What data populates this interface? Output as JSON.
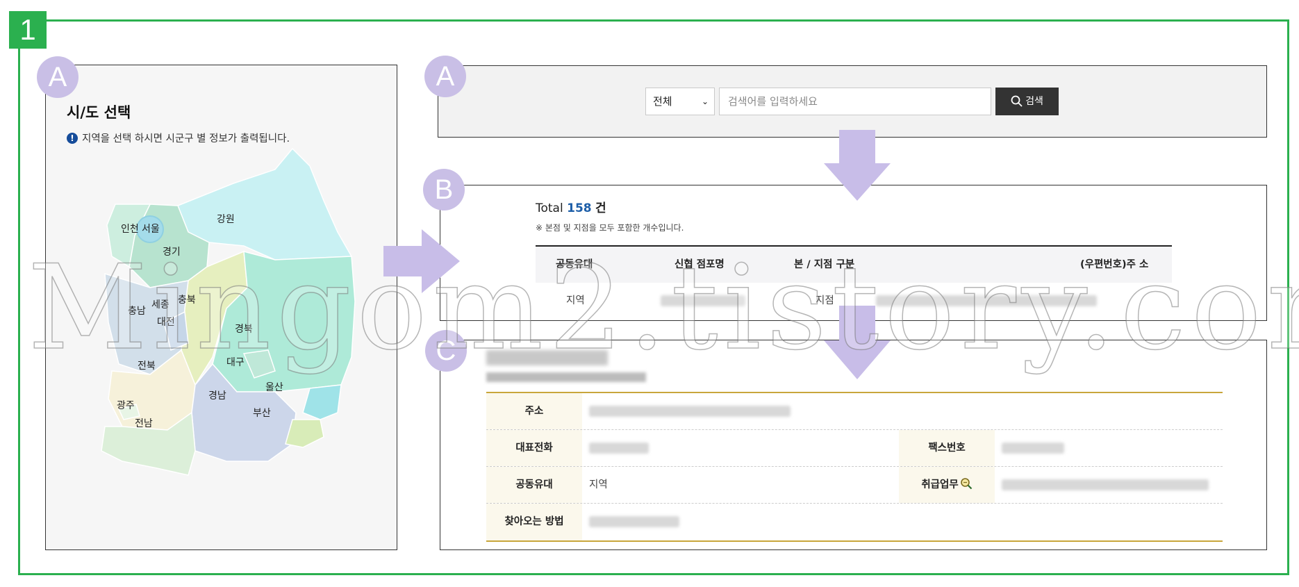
{
  "step_badge": "1",
  "markers": {
    "map": "A",
    "search": "A",
    "results": "B",
    "detail": "C"
  },
  "map_panel": {
    "title": "시/도 선택",
    "info": "지역을 선택 하시면 시군구 별 정보가 출력됩니다.",
    "info_icon": "exclamation-circle-icon",
    "regions": [
      "인천",
      "서울",
      "강원",
      "경기",
      "세종",
      "충북",
      "충남",
      "대전",
      "경북",
      "전북",
      "대구",
      "울산",
      "경남",
      "광주",
      "부산",
      "전남"
    ]
  },
  "search": {
    "scope_value": "전체",
    "placeholder": "검색어를 입력하세요",
    "button_label": "검색",
    "button_icon": "search-icon"
  },
  "results": {
    "total_prefix": "Total",
    "total_count": "158",
    "total_unit": "건",
    "note": "※ 본점 및 지점을 모두 포함한 개수입니다.",
    "columns": [
      "공동유대",
      "신협 점포명",
      "본 / 지점 구분",
      "(우편번호)주 소"
    ],
    "row": {
      "bond": "지역",
      "type": "지점"
    }
  },
  "detail": {
    "labels": {
      "address": "주소",
      "phone": "대표전화",
      "fax": "팩스번호",
      "bond": "공동유대",
      "services": "취급업무",
      "directions": "찾아오는 방법"
    },
    "bond_value": "지역",
    "services_icon": "magnifier-icon"
  },
  "watermark": "Mingom2.tistory.com",
  "colors": {
    "frame": "#2bb04f",
    "marker": "#c9bfe6",
    "arrow": "#c8bde8",
    "accent_blue": "#1d5ea8",
    "gold_rule": "#c8a63b",
    "button_dark": "#333333"
  }
}
